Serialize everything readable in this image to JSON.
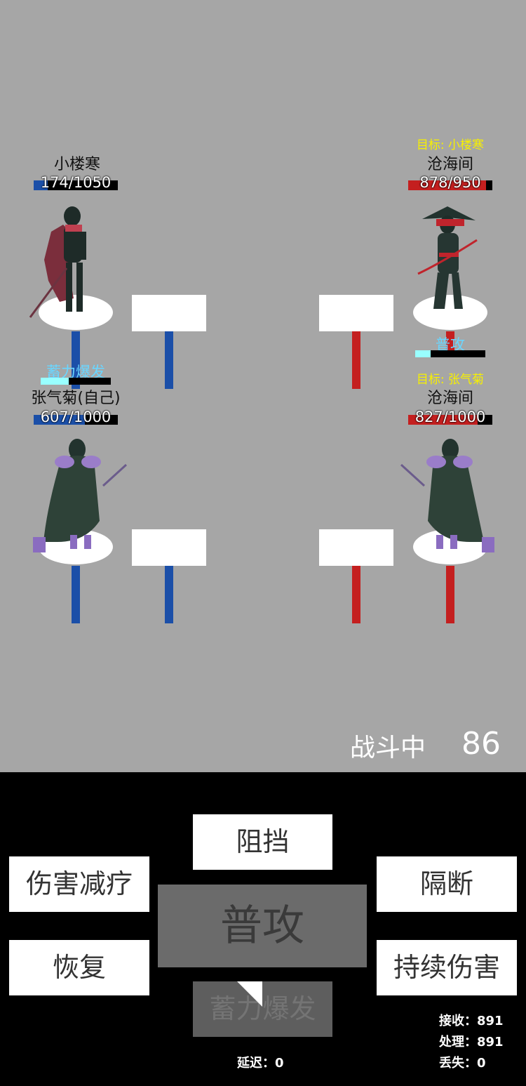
{
  "allies": [
    {
      "name": "小楼寒",
      "hp": "174/1050",
      "hp_fraction": 0.166
    },
    {
      "name": "张气菊(自己)",
      "hp": "607/1000",
      "hp_fraction": 0.607,
      "cast": "蓄力爆发"
    }
  ],
  "enemies": [
    {
      "target": "目标: 小楼寒",
      "name": "沧海间",
      "hp": "878/950",
      "hp_fraction": 0.924,
      "cast": "普攻"
    },
    {
      "target": "目标: 张气菊",
      "name": "沧海间",
      "hp": "827/1000",
      "hp_fraction": 0.827
    }
  ],
  "battle": {
    "status": "战斗中",
    "timer": "86"
  },
  "skills": {
    "block": "阻挡",
    "damage_reduce_heal": "伤害减疗",
    "interrupt": "隔断",
    "basic_attack": "普攻",
    "recover": "恢复",
    "dot": "持续伤害",
    "charge_burst": "蓄力爆发"
  },
  "network": {
    "delay": "延迟：0",
    "received": "接收：891",
    "processed": "处理：891",
    "lost": "丢失：0"
  },
  "colors": {
    "ally": "#1b4fa8",
    "enemy": "#c41f1f",
    "target": "#f7f000",
    "cast": "#6ad6ff"
  }
}
